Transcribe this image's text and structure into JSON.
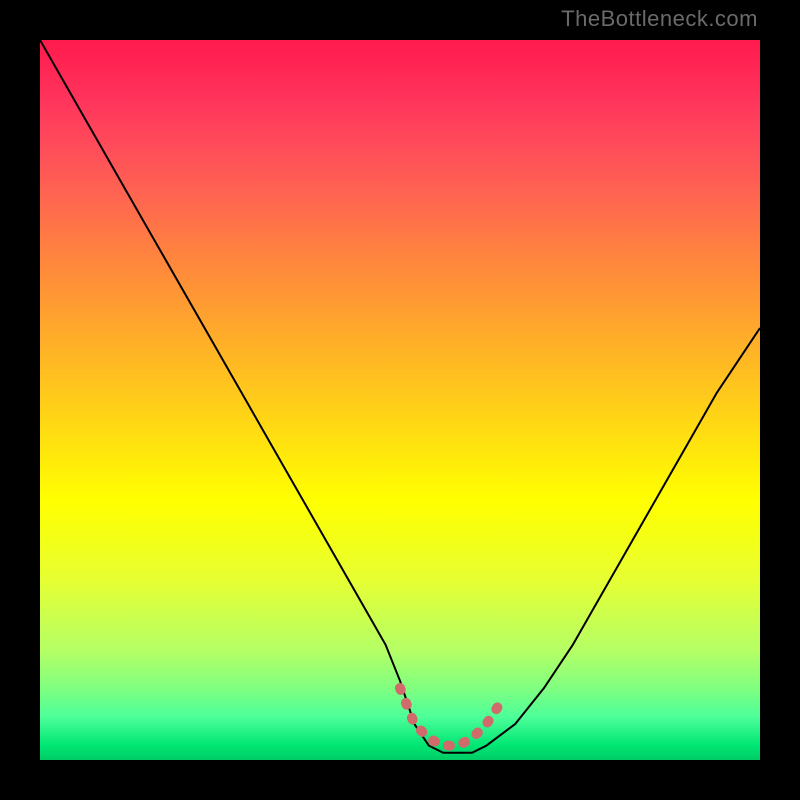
{
  "watermark": "TheBottleneck.com",
  "chart_data": {
    "type": "line",
    "title": "",
    "xlabel": "",
    "ylabel": "",
    "xlim": [
      0,
      100
    ],
    "ylim": [
      0,
      100
    ],
    "series": [
      {
        "name": "bottleneck-curve",
        "x": [
          0,
          4,
          8,
          12,
          16,
          20,
          24,
          28,
          32,
          36,
          40,
          44,
          48,
          50,
          52,
          54,
          56,
          58,
          60,
          62,
          66,
          70,
          74,
          78,
          82,
          86,
          90,
          94,
          98,
          100
        ],
        "values": [
          100,
          93,
          86,
          79,
          72,
          65,
          58,
          51,
          44,
          37,
          30,
          23,
          16,
          11,
          5,
          2,
          1,
          1,
          1,
          2,
          5,
          10,
          16,
          23,
          30,
          37,
          44,
          51,
          57,
          60
        ]
      },
      {
        "name": "highlight-band",
        "x": [
          50,
          52,
          54,
          56,
          58,
          60,
          62,
          64
        ],
        "values": [
          10,
          5,
          3,
          2,
          2,
          3,
          5,
          8
        ]
      }
    ]
  },
  "colors": {
    "curve": "#000000",
    "highlight": "#d16a6a",
    "frame_bg": "#000000"
  }
}
